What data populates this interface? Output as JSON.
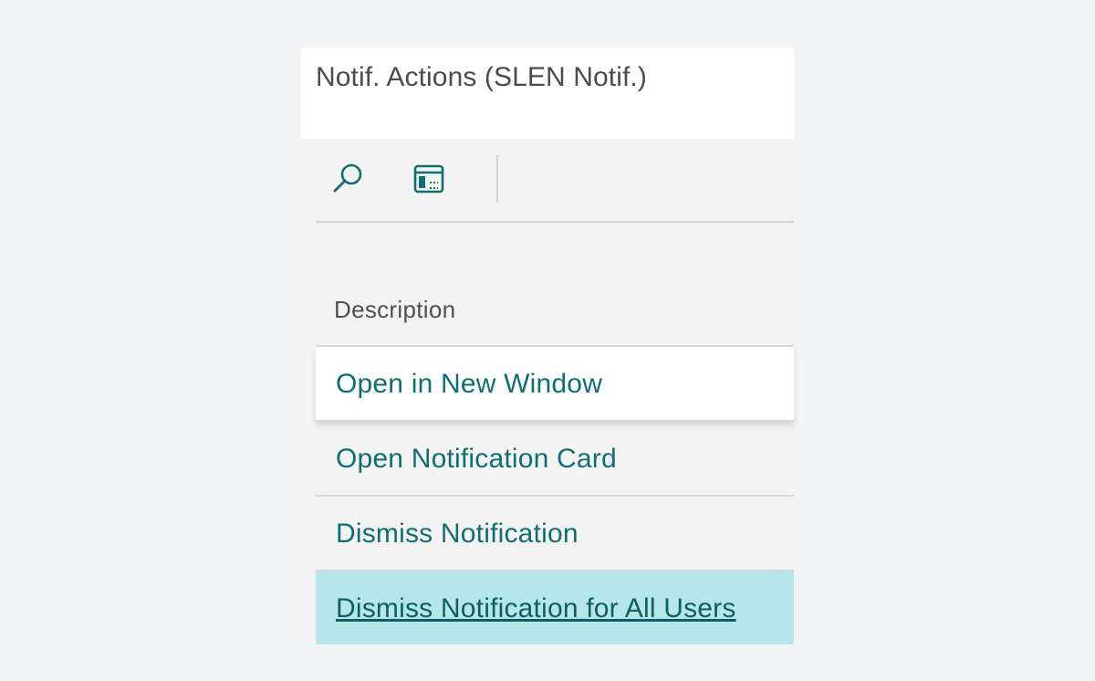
{
  "page": {
    "title": "Notif. Actions (SLEN Notif.)"
  },
  "toolbar": {
    "search_icon": "search-icon",
    "layout_icon": "layout-icon"
  },
  "list": {
    "column_header": "Description",
    "rows": [
      {
        "label": "Open in New Window"
      },
      {
        "label": "Open Notification Card"
      },
      {
        "label": "Dismiss Notification"
      },
      {
        "label": "Dismiss Notification for All Users"
      }
    ]
  },
  "colors": {
    "accent": "#0f6e74",
    "highlight": "#b4e6ea"
  }
}
